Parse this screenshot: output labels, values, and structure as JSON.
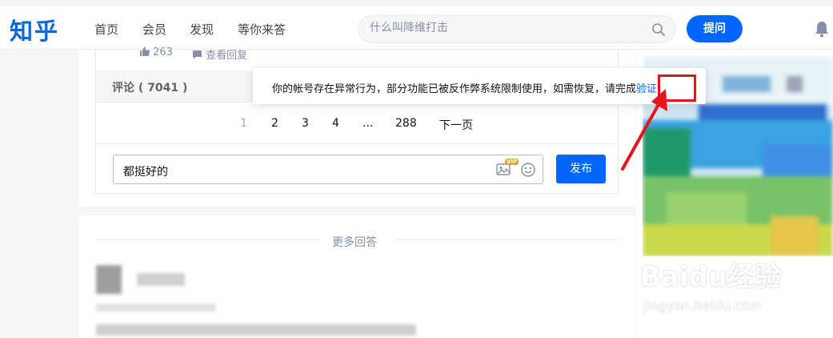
{
  "header": {
    "logo": "知乎",
    "nav": [
      "首页",
      "会员",
      "发现",
      "等你来答"
    ],
    "search_placeholder": "什么叫降维打击",
    "ask_label": "提问"
  },
  "answer": {
    "likes": "263",
    "view_replies": "查看回复"
  },
  "comments": {
    "title": "评论 ( 7041 )",
    "pages": [
      "1",
      "2",
      "3",
      "4",
      "...",
      "288"
    ],
    "next_label": "下一页",
    "input_value": "都挺好的",
    "vip_badge": "VIP",
    "publish_label": "发布"
  },
  "toast": {
    "message": "你的帐号存在异常行为，部分功能已被反作弊系统限制使用，如需恢复，请完成",
    "link": "验证"
  },
  "more_answers": {
    "title": "更多回答"
  },
  "watermark": {
    "brand": "Baidu经验",
    "url": "jingyan.baidu.com"
  },
  "colors": {
    "brand": "#0066ff",
    "logo": "#0a66dc",
    "highlight": "#e6141b"
  }
}
